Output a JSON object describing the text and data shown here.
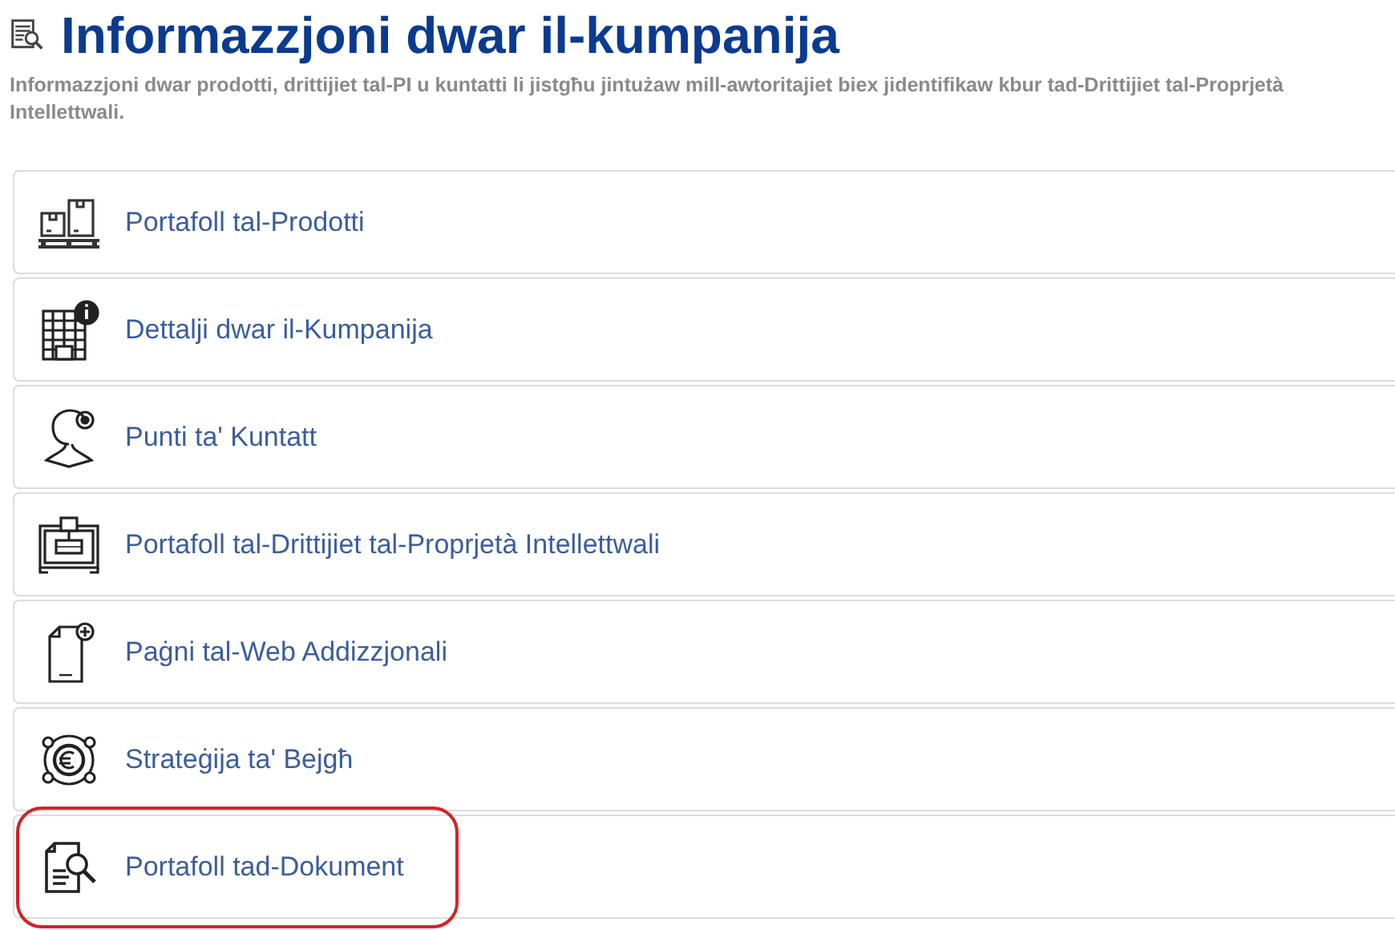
{
  "header": {
    "title": "Informazzjoni dwar il-kumpanija",
    "description": "Informazzjoni dwar prodotti, drittijiet tal-PI u kuntatti li jistgħu jintużaw mill-awtoritajiet biex jidentifikaw kbur tad-Drittijiet tal-Proprjetà Intellettwali."
  },
  "items": [
    {
      "label": "Portafoll tal-Prodotti",
      "kind": "pallet",
      "highlighted": false
    },
    {
      "label": "Dettalji dwar il-Kumpanija",
      "kind": "building",
      "highlighted": false
    },
    {
      "label": "Punti ta' Kuntatt",
      "kind": "contact",
      "highlighted": false
    },
    {
      "label": "Portafoll tal-Drittijiet tal-Proprjetà Intellettwali",
      "kind": "ipr",
      "highlighted": false
    },
    {
      "label": "Paġni tal-Web Addizzjonali",
      "kind": "webpage",
      "highlighted": false
    },
    {
      "label": "Strateġija ta' Bejgħ",
      "kind": "euro",
      "highlighted": false
    },
    {
      "label": "Portafoll tad-Dokument",
      "kind": "document",
      "highlighted": true
    }
  ]
}
